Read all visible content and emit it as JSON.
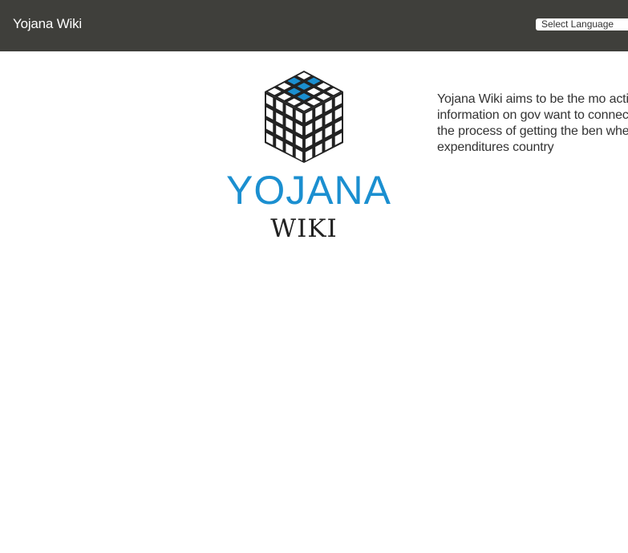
{
  "header": {
    "site_title": "Yojana Wiki",
    "language_select": "Select Language"
  },
  "logo": {
    "word_top": "YOJANA",
    "word_bottom": "WIKI",
    "accent_color": "#1b8fd0",
    "dark_color": "#222222"
  },
  "about": {
    "text": "Yojana Wiki aims to be the mo actionable information on gov want to connect users to the r the process of getting the ben when it comes to expenditures country"
  }
}
